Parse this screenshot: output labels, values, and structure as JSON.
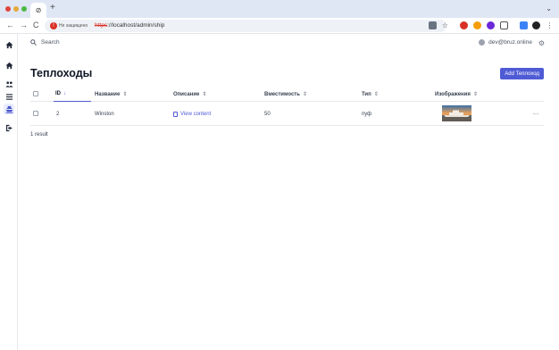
{
  "browser": {
    "tab_icon": "⊘",
    "new_tab": "+",
    "tab_menu": "⌄",
    "nav": {
      "back": "←",
      "forward": "→",
      "reload": "C"
    },
    "security_warning": "Не защищено",
    "url_scheme": "https",
    "url_rest": "://localhost/admin/ship"
  },
  "sidebar": {
    "items": [
      {
        "name": "home",
        "icon": "home-icon"
      },
      {
        "name": "home-2",
        "icon": "home-icon"
      },
      {
        "name": "users",
        "icon": "users-icon"
      },
      {
        "name": "list",
        "icon": "list-icon"
      },
      {
        "name": "ships",
        "icon": "ship-icon",
        "active": true
      },
      {
        "name": "logout",
        "icon": "logout-icon"
      }
    ]
  },
  "topbar": {
    "search_label": "Search",
    "user_email": "dev@bruz.online",
    "settings_icon": "⚙"
  },
  "page": {
    "title": "Теплоходы",
    "add_button": "Add Теплоход",
    "result_count": "1 result"
  },
  "table": {
    "sort_icon": "⇕",
    "sort_active_icon": "↓",
    "headers": {
      "id": "ID",
      "name": "Название",
      "description": "Описание",
      "capacity": "Вместимость",
      "type": "Тип",
      "images": "Изображения"
    },
    "rows": [
      {
        "id": "2",
        "name": "Winston",
        "description": "View content",
        "capacity": "50",
        "type": "пуф",
        "menu": "···"
      }
    ]
  },
  "colors": {
    "accent": "#4f5bd5",
    "tabbar": "#dfe7f5",
    "warning": "#d93025"
  }
}
